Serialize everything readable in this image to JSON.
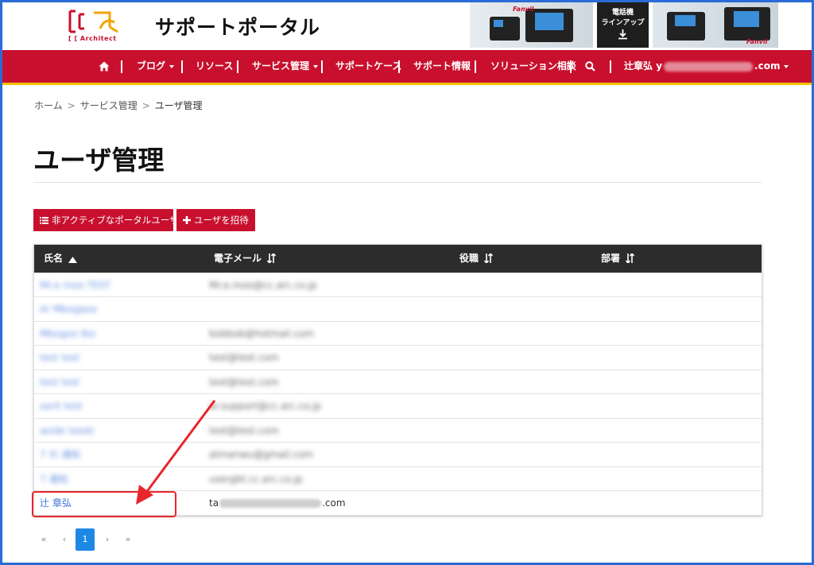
{
  "header": {
    "logo_text": "Architect",
    "portal_title": "サポートポータル",
    "banner": {
      "brand_left": "Fanvil",
      "mid_line1": "電話機",
      "mid_line2": "ラインアップ",
      "brand_right": "Fanvil"
    }
  },
  "nav": {
    "items": [
      {
        "label": "ブログ",
        "dropdown": true
      },
      {
        "label": "リソース",
        "dropdown": false
      },
      {
        "label": "サービス管理",
        "dropdown": true
      },
      {
        "label": "サポートケース",
        "dropdown": false
      },
      {
        "label": "サポート情報",
        "dropdown": false
      },
      {
        "label": "ソリューション相談",
        "dropdown": false
      }
    ],
    "user_name": "辻章弘",
    "user_prefix": "y",
    "user_suffix": ".com"
  },
  "breadcrumb": {
    "home": "ホーム",
    "service": "サービス管理",
    "current": "ユーザ管理",
    "separator": ">"
  },
  "page": {
    "title": "ユーザ管理",
    "btn_inactive": "非アクティブなポータルユーザ",
    "btn_invite": "ユーザを招待"
  },
  "table": {
    "headers": {
      "name": "氏名",
      "email": "電子メール",
      "role": "役職",
      "dept": "部署"
    },
    "rows": [
      {
        "name": "Mr.e moo TEST",
        "email": "Mr.e.moo@cc.arc.co.jp"
      },
      {
        "name": "Ar Mbogaoo",
        "email": ""
      },
      {
        "name": "Mbogoo Ibo",
        "email": "bobbob@hotmail.com"
      },
      {
        "name": "test test",
        "email": "test@test.com"
      },
      {
        "name": "test test",
        "email": "test@test.com"
      },
      {
        "name": "sarit test",
        "email": "ar.support@cc.arc.co.jp"
      },
      {
        "name": "aside toodc",
        "email": "test@test.com"
      },
      {
        "name": "7 の 通知",
        "email": "atmanwu@gmail.com"
      },
      {
        "name": "7 通知",
        "email": "usergbt.cc.arc.co.jp"
      },
      {
        "name": "辻 章弘",
        "email_prefix": "ta",
        "email_suffix": ".com"
      }
    ]
  },
  "pagination": {
    "first": "«",
    "prev": "‹",
    "current": "1",
    "next": "›",
    "last": "»"
  },
  "colors": {
    "brand_red": "#c8102e",
    "nav_underline": "#f2c200",
    "table_header": "#2c2c2c",
    "link_blue": "#3b6fd8",
    "pager_active": "#1e88e5",
    "annotation_red": "#e8262b"
  }
}
